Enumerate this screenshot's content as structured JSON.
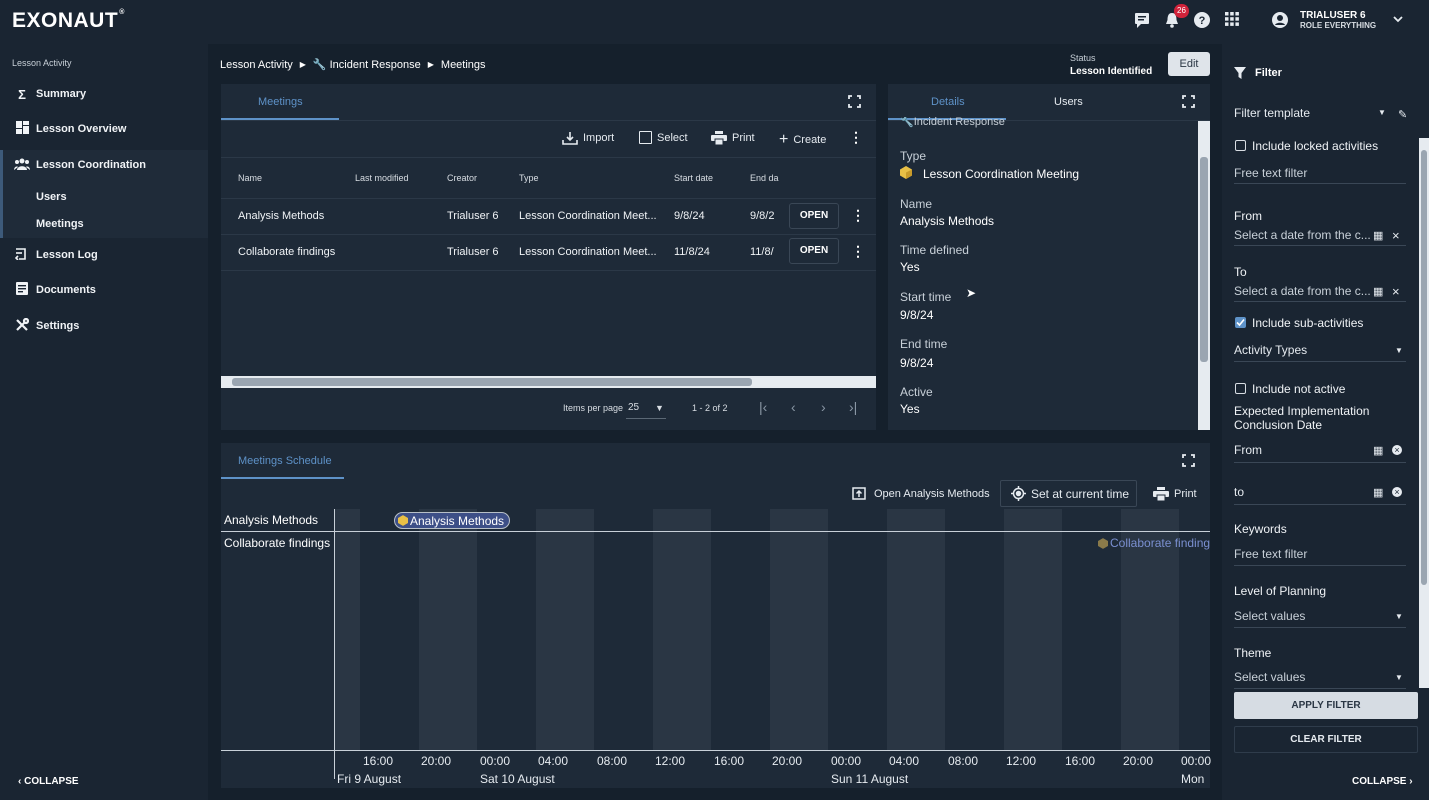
{
  "app": {
    "logo": "EXONAUT",
    "logo_mark": "®"
  },
  "topbar": {
    "notification_count": "26",
    "user_name": "TRIALUSER 6",
    "user_role": "ROLE EVERYTHING"
  },
  "sidebar": {
    "heading": "Lesson Activity",
    "items": [
      {
        "label": "Summary",
        "icon": "sigma-icon"
      },
      {
        "label": "Lesson Overview",
        "icon": "dashboard-icon"
      },
      {
        "label": "Lesson Coordination",
        "icon": "group-icon"
      },
      {
        "label": "Lesson Log",
        "icon": "log-icon"
      },
      {
        "label": "Documents",
        "icon": "document-icon"
      },
      {
        "label": "Settings",
        "icon": "tools-icon"
      }
    ],
    "sub_items": [
      "Users",
      "Meetings"
    ],
    "collapse": "COLLAPSE"
  },
  "breadcrumb": [
    "Lesson Activity",
    "Incident Response",
    "Meetings"
  ],
  "status": {
    "label": "Status",
    "value": "Lesson Identified",
    "edit": "Edit"
  },
  "meetings": {
    "tab": "Meetings",
    "toolbar": {
      "import": "Import",
      "select": "Select",
      "print": "Print",
      "create": "Create"
    },
    "columns": [
      "Name",
      "Last modified",
      "Creator",
      "Type",
      "Start date",
      "End da"
    ],
    "rows": [
      {
        "name": "Analysis Methods",
        "last_modified": "",
        "creator": "Trialuser 6",
        "type": "Lesson Coordination Meet...",
        "start": "9/8/24",
        "end": "9/8/2",
        "action": "OPEN"
      },
      {
        "name": "Collaborate findings",
        "last_modified": "",
        "creator": "Trialuser 6",
        "type": "Lesson Coordination Meet...",
        "start": "11/8/24",
        "end": "11/8/",
        "action": "OPEN"
      }
    ],
    "pager": {
      "items_label": "Items per page",
      "per_page": "25",
      "range": "1 - 2 of 2"
    }
  },
  "details": {
    "tabs": [
      "Details",
      "Users"
    ],
    "parent": "Incident Response",
    "fields": [
      {
        "label": "Type",
        "value": "Lesson Coordination Meeting"
      },
      {
        "label": "Name",
        "value": "Analysis Methods"
      },
      {
        "label": "Time defined",
        "value": "Yes"
      },
      {
        "label": "Start time",
        "value": "9/8/24"
      },
      {
        "label": "End time",
        "value": "9/8/24"
      },
      {
        "label": "Active",
        "value": "Yes"
      }
    ]
  },
  "schedule": {
    "tab": "Meetings Schedule",
    "toolbar": {
      "open": "Open Analysis Methods",
      "set_time": "Set at current time",
      "print": "Print"
    },
    "rows": [
      "Analysis Methods",
      "Collaborate findings"
    ],
    "events": [
      "Analysis Methods",
      "Collaborate finding"
    ],
    "ticks": [
      "16:00",
      "20:00",
      "00:00",
      "04:00",
      "08:00",
      "12:00",
      "16:00",
      "20:00",
      "00:00",
      "04:00",
      "08:00",
      "12:00",
      "16:00",
      "20:00",
      "00:00"
    ],
    "dates": [
      "Fri 9 August",
      "Sat 10 August",
      "Sun 11 August",
      "Mon"
    ]
  },
  "filter": {
    "title": "Filter",
    "template": "Filter template",
    "include_locked": "Include locked activities",
    "free_text": "Free text filter",
    "from": "From",
    "to": "To",
    "date_placeholder": "Select a date from the c...",
    "include_sub": "Include sub-activities",
    "activity_types": "Activity Types",
    "include_not_active": "Include not active",
    "expected": "Expected Implementation Conclusion Date",
    "from2": "From",
    "to2": "to",
    "keywords": "Keywords",
    "keywords_ph": "Free text filter",
    "level": "Level of Planning",
    "select_values": "Select values",
    "theme": "Theme",
    "theme_ph": "Select values",
    "apply": "APPLY FILTER",
    "clear": "CLEAR FILTER",
    "collapse": "COLLAPSE"
  }
}
